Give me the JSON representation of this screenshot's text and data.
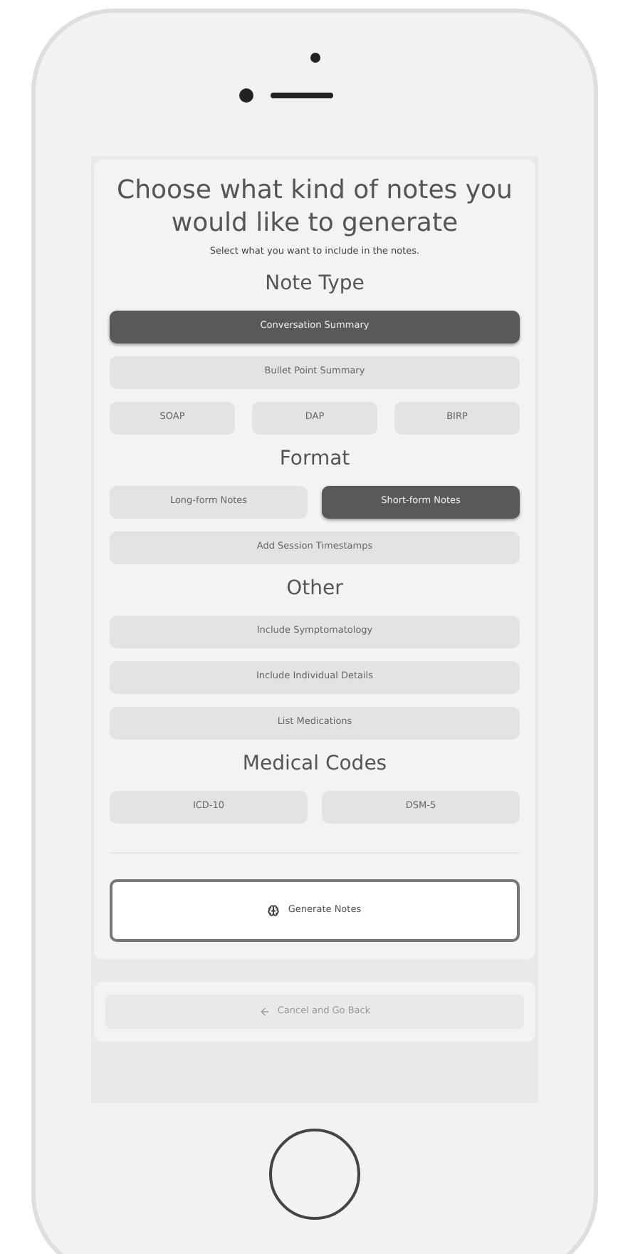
{
  "title": "Choose what kind of notes you would like to generate",
  "subtitle": "Select what you want to include in the notes.",
  "sections": [
    {
      "heading": "Note Type",
      "rows": [
        [
          {
            "label": "Conversation Summary",
            "selected": true
          }
        ],
        [
          {
            "label": "Bullet Point Summary",
            "selected": false
          }
        ],
        [
          {
            "label": "SOAP",
            "selected": false
          },
          {
            "label": "DAP",
            "selected": false
          },
          {
            "label": "BIRP",
            "selected": false
          }
        ]
      ]
    },
    {
      "heading": "Format",
      "rows": [
        [
          {
            "label": "Long-form Notes",
            "selected": false
          },
          {
            "label": "Short-form Notes",
            "selected": true
          }
        ],
        [
          {
            "label": "Add Session Timestamps",
            "selected": false
          }
        ]
      ]
    },
    {
      "heading": "Other",
      "rows": [
        [
          {
            "label": "Include Symptomatology",
            "selected": false
          }
        ],
        [
          {
            "label": "Include Individual Details",
            "selected": false
          }
        ],
        [
          {
            "label": "List Medications",
            "selected": false
          }
        ]
      ]
    },
    {
      "heading": "Medical Codes",
      "rows": [
        [
          {
            "label": "ICD-10",
            "selected": false
          },
          {
            "label": "DSM-5",
            "selected": false
          }
        ]
      ]
    }
  ],
  "generate_button": "Generate Notes",
  "cancel_button": "Cancel and Go Back"
}
